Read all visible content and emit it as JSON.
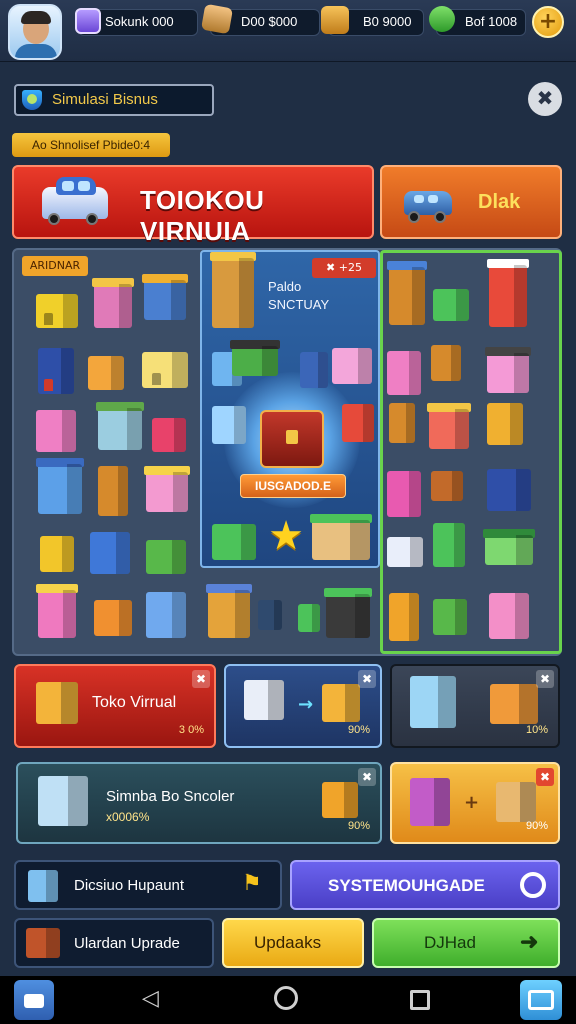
{
  "resources": [
    {
      "value": "Sokunk 000",
      "icon": "gem-icon",
      "color": "#7a5cff"
    },
    {
      "value": "D00 $000",
      "icon": "box-icon",
      "color": "#d89a3e"
    },
    {
      "value": "B0 9000",
      "icon": "crate-icon",
      "color": "#e0a43b"
    },
    {
      "value": "Bof 1008",
      "icon": "gift-icon",
      "color": "#4fbf4a"
    }
  ],
  "header": {
    "badge": "Simulasi Bisnus",
    "sub_badge": "Ao Shnolisef Pbide0:4",
    "close": "✖",
    "plus": "+"
  },
  "banner": {
    "title": "TOIOKOU VIRNUIA",
    "side_title": "Dlak"
  },
  "grid": {
    "corner_label": "ARIDNAR",
    "center_badge": "✖ +25",
    "center_text_1": "Paldo",
    "center_text_2": "SNCTUAY",
    "center_cta": "IUSGADOD.E",
    "star": "★"
  },
  "cards": {
    "c1_label": "Toko Virrual",
    "c1_pct": "3 0%",
    "c2_pct": "90%",
    "c3_pct": "10%",
    "c4_label": "Simnba Bo Sncoler",
    "c4_sub": "x0006%",
    "c4_pct": "90%",
    "c5_pct": "90%",
    "arrow": "→",
    "x": "✖"
  },
  "buttons": {
    "dicsisio": "Dicsiuo Hupaunt",
    "system_upgrade": "SYSTEMOUHGADE",
    "ulardan": "Ulardan Uprade",
    "updacks": "Updaaks",
    "dhad": "DJHad"
  },
  "colors": {
    "primary_red": "#d62a1e",
    "accent_green": "#69d34c",
    "system_purple": "#5b4fd8",
    "update_yellow": "#f5c21b",
    "go_green": "#5fc940"
  }
}
